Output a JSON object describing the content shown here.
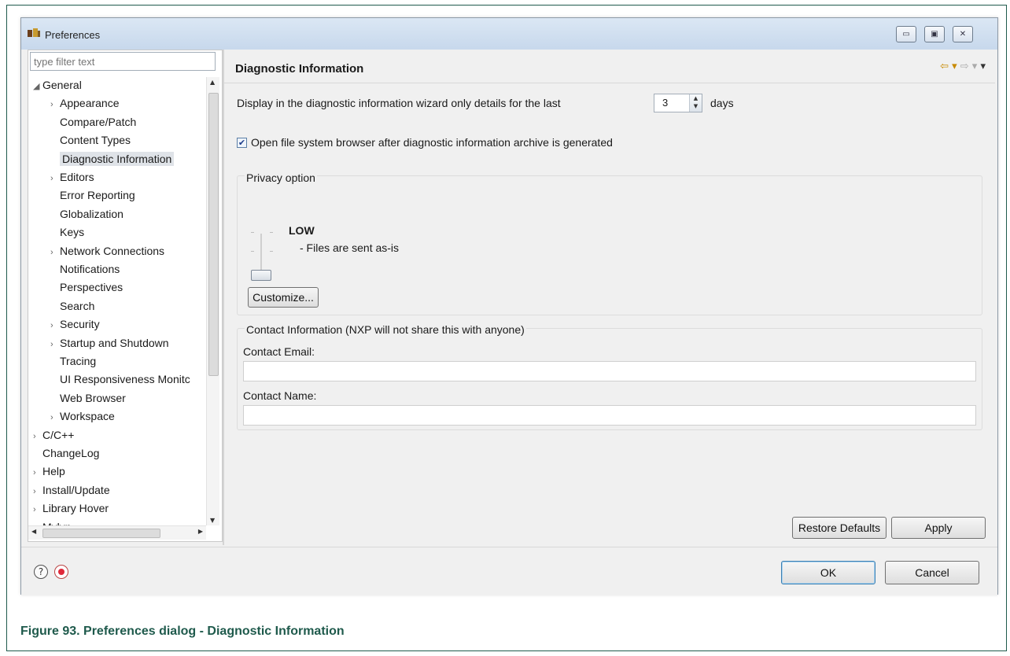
{
  "window": {
    "title": "Preferences"
  },
  "filter": {
    "placeholder": "type filter text"
  },
  "tree": {
    "items": [
      {
        "label": "General",
        "arrow": "◢",
        "indent": 0
      },
      {
        "label": "Appearance",
        "arrow": "›",
        "indent": 1
      },
      {
        "label": "Compare/Patch",
        "arrow": "",
        "indent": 1
      },
      {
        "label": "Content Types",
        "arrow": "",
        "indent": 1
      },
      {
        "label": "Diagnostic Information",
        "arrow": "",
        "indent": 1
      },
      {
        "label": "Editors",
        "arrow": "›",
        "indent": 1
      },
      {
        "label": "Error Reporting",
        "arrow": "",
        "indent": 1
      },
      {
        "label": "Globalization",
        "arrow": "",
        "indent": 1
      },
      {
        "label": "Keys",
        "arrow": "",
        "indent": 1
      },
      {
        "label": "Network Connections",
        "arrow": "›",
        "indent": 1
      },
      {
        "label": "Notifications",
        "arrow": "",
        "indent": 1
      },
      {
        "label": "Perspectives",
        "arrow": "",
        "indent": 1
      },
      {
        "label": "Search",
        "arrow": "",
        "indent": 1
      },
      {
        "label": "Security",
        "arrow": "›",
        "indent": 1
      },
      {
        "label": "Startup and Shutdown",
        "arrow": "›",
        "indent": 1
      },
      {
        "label": "Tracing",
        "arrow": "",
        "indent": 1
      },
      {
        "label": "UI Responsiveness Monitc",
        "arrow": "",
        "indent": 1
      },
      {
        "label": "Web Browser",
        "arrow": "",
        "indent": 1
      },
      {
        "label": "Workspace",
        "arrow": "›",
        "indent": 1
      },
      {
        "label": "C/C++",
        "arrow": "›",
        "indent": 0
      },
      {
        "label": "ChangeLog",
        "arrow": "",
        "indent": 0
      },
      {
        "label": "Help",
        "arrow": "›",
        "indent": 0
      },
      {
        "label": "Install/Update",
        "arrow": "›",
        "indent": 0
      },
      {
        "label": "Library Hover",
        "arrow": "›",
        "indent": 0
      },
      {
        "label": "Mylyn",
        "arrow": "›",
        "indent": 0
      }
    ]
  },
  "page": {
    "title": "Diagnostic Information",
    "days_label": "Display in the diagnostic information wizard only details for the last",
    "days_value": "3",
    "days_unit": "days",
    "open_browser_label": "Open file system browser after diagnostic information archive is generated",
    "open_browser_checked": true,
    "privacy": {
      "group_label": "Privacy option",
      "level": "LOW",
      "level_desc": "- Files are sent as-is",
      "customize_label": "Customize..."
    },
    "contact": {
      "group_label": "Contact Information (NXP will not share this with anyone)",
      "email_label": "Contact Email:",
      "email_value": "",
      "name_label": "Contact Name:",
      "name_value": ""
    },
    "restore_label": "Restore Defaults",
    "apply_label": "Apply"
  },
  "footer": {
    "ok_label": "OK",
    "cancel_label": "Cancel"
  },
  "caption": "Figure 93.  Preferences dialog - Diagnostic Information",
  "colors": {
    "caption": "#1f5a4c",
    "selection": "#dfe3e8",
    "nav_arrow": "#c88a00"
  }
}
